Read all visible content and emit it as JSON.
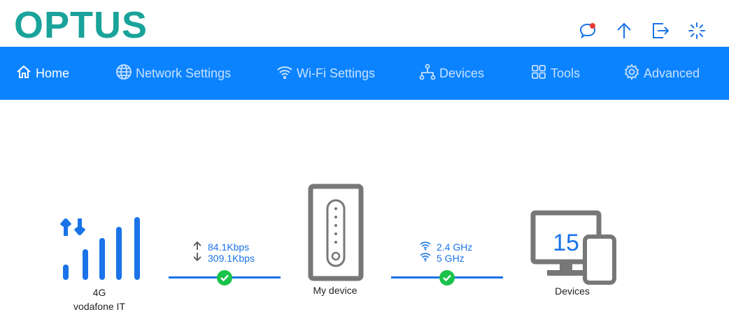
{
  "brand": {
    "logo": "OPTUS",
    "color": "#1aa39a"
  },
  "header_icons": [
    "chat-icon",
    "upload-icon",
    "logout-icon",
    "loading-icon"
  ],
  "nav": {
    "items": [
      {
        "label": "Home",
        "icon": "home-icon",
        "active": true
      },
      {
        "label": "Network Settings",
        "icon": "globe-icon"
      },
      {
        "label": "Wi-Fi Settings",
        "icon": "wifi-icon"
      },
      {
        "label": "Devices",
        "icon": "network-icon"
      },
      {
        "label": "Tools",
        "icon": "grid-icon"
      },
      {
        "label": "Advanced",
        "icon": "gear-icon"
      }
    ],
    "bg_color": "#0b83ff"
  },
  "status": {
    "network": {
      "type": "4G",
      "operator": "vodafone IT"
    },
    "speed": {
      "upload": "84.1Kbps",
      "download": "309.1Kbps"
    },
    "my_device": {
      "label": "My device"
    },
    "wifi": {
      "band1": "2.4 GHz",
      "band2": "5 GHz"
    },
    "devices": {
      "count": "15",
      "label": "Devices"
    }
  },
  "colors": {
    "accent": "#1a73e8",
    "ok": "#19c24a",
    "device_gray": "#777777"
  }
}
